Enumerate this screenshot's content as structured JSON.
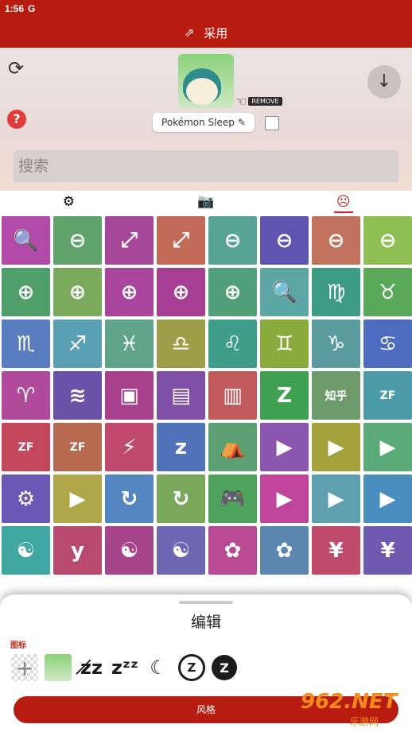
{
  "status": {
    "time": "1:56",
    "carrier_icon": "G"
  },
  "appbar": {
    "icon": "apply-icon",
    "title": "采用"
  },
  "header": {
    "app_name": "Pokémon Sleep",
    "remove_label": "REMOVE",
    "search_placeholder": "搜索"
  },
  "tabs": [
    {
      "icon": "gear-tab-icon",
      "glyph": "⚙"
    },
    {
      "icon": "camera-tab-icon",
      "glyph": "📷"
    },
    {
      "icon": "face-tab-icon",
      "glyph": "☹"
    }
  ],
  "grid": [
    {
      "g": "🔍",
      "c": "#b14aa8"
    },
    {
      "g": "⊖",
      "c": "#5fa36a"
    },
    {
      "g": "⤢",
      "c": "#a6479a"
    },
    {
      "g": "⤢",
      "c": "#c26b58"
    },
    {
      "g": "⊖",
      "c": "#57a394"
    },
    {
      "g": "⊖",
      "c": "#6054b0"
    },
    {
      "g": "⊖",
      "c": "#c2735e"
    },
    {
      "g": "⊖",
      "c": "#8fbf52"
    },
    {
      "g": "⊕",
      "c": "#4f9f6b"
    },
    {
      "g": "⊕",
      "c": "#7aab5c"
    },
    {
      "g": "⊕",
      "c": "#a9459d"
    },
    {
      "g": "⊕",
      "c": "#a63e94"
    },
    {
      "g": "⊕",
      "c": "#52a07a"
    },
    {
      "g": "🔍",
      "c": "#5ca6a3"
    },
    {
      "g": "♍",
      "c": "#3d9a83"
    },
    {
      "g": "♉",
      "c": "#5aa85a"
    },
    {
      "g": "♏",
      "c": "#5a7dc0"
    },
    {
      "g": "♐",
      "c": "#5aa0b5"
    },
    {
      "g": "♓",
      "c": "#5fa38b"
    },
    {
      "g": "♎",
      "c": "#9e9e4a"
    },
    {
      "g": "♌",
      "c": "#3f9e8a"
    },
    {
      "g": "♊",
      "c": "#8aaa3c"
    },
    {
      "g": "♑",
      "c": "#5a9ba0"
    },
    {
      "g": "♋",
      "c": "#4d6cc0"
    },
    {
      "g": "♈",
      "c": "#b04a9a"
    },
    {
      "g": "≋",
      "c": "#6a52a8"
    },
    {
      "g": "▣",
      "c": "#a8408c"
    },
    {
      "g": "▤",
      "c": "#7f50a8"
    },
    {
      "g": "▥",
      "c": "#c05a5a"
    },
    {
      "g": "Z",
      "c": "#3fa052"
    },
    {
      "g": "知乎",
      "c": "#6d9a6a",
      "s": 1
    },
    {
      "g": "ZF",
      "c": "#4d9aa8",
      "s": 1
    },
    {
      "g": "ZF",
      "c": "#c2475a",
      "s": 1
    },
    {
      "g": "ZF",
      "c": "#b86a50",
      "s": 1
    },
    {
      "g": "⚡",
      "c": "#c0496e"
    },
    {
      "g": "z",
      "c": "#4f72b8"
    },
    {
      "g": "⛺",
      "c": "#5c9f72"
    },
    {
      "g": "▶",
      "c": "#8a56b0"
    },
    {
      "g": "▶",
      "c": "#a4a23c"
    },
    {
      "g": "▶",
      "c": "#5aaa78"
    },
    {
      "g": "⚙",
      "c": "#6a58b4"
    },
    {
      "g": "▶",
      "c": "#b0a64a"
    },
    {
      "g": "↻",
      "c": "#5585c0"
    },
    {
      "g": "↻",
      "c": "#7aa85a"
    },
    {
      "g": "🎮",
      "c": "#4ea25c"
    },
    {
      "g": "▶",
      "c": "#c0449a"
    },
    {
      "g": "▶",
      "c": "#5fa0b0"
    },
    {
      "g": "▶",
      "c": "#4a8ec0"
    },
    {
      "g": "☯",
      "c": "#3fa6a0"
    },
    {
      "g": "y",
      "c": "#b84a70"
    },
    {
      "g": "☯",
      "c": "#a6448c"
    },
    {
      "g": "☯",
      "c": "#6e68b4"
    },
    {
      "g": "✿",
      "c": "#b84a94"
    },
    {
      "g": "✿",
      "c": "#5a86b0"
    },
    {
      "g": "¥",
      "c": "#c04a6c"
    },
    {
      "g": "¥",
      "c": "#6e5ab0"
    }
  ],
  "sheet": {
    "title": "编辑",
    "section_label": "图标",
    "style_button": "风格",
    "watermark": "962.NET",
    "watermark_sub": "乐游网"
  },
  "edit_icons": [
    {
      "name": "add-icon",
      "g": "+",
      "cls": "add"
    },
    {
      "name": "snorlax-icon",
      "g": "",
      "cls": "mini"
    },
    {
      "name": "sleep-off-icon",
      "g": "z̸z",
      "cls": ""
    },
    {
      "name": "zzz-icon",
      "g": "zᶻᶻ",
      "cls": ""
    },
    {
      "name": "moon-icon",
      "g": "☾",
      "cls": ""
    },
    {
      "name": "z-outline-icon",
      "g": "Z",
      "cls": "circ"
    },
    {
      "name": "z-filled-icon",
      "g": "Z",
      "cls": "circf"
    }
  ]
}
